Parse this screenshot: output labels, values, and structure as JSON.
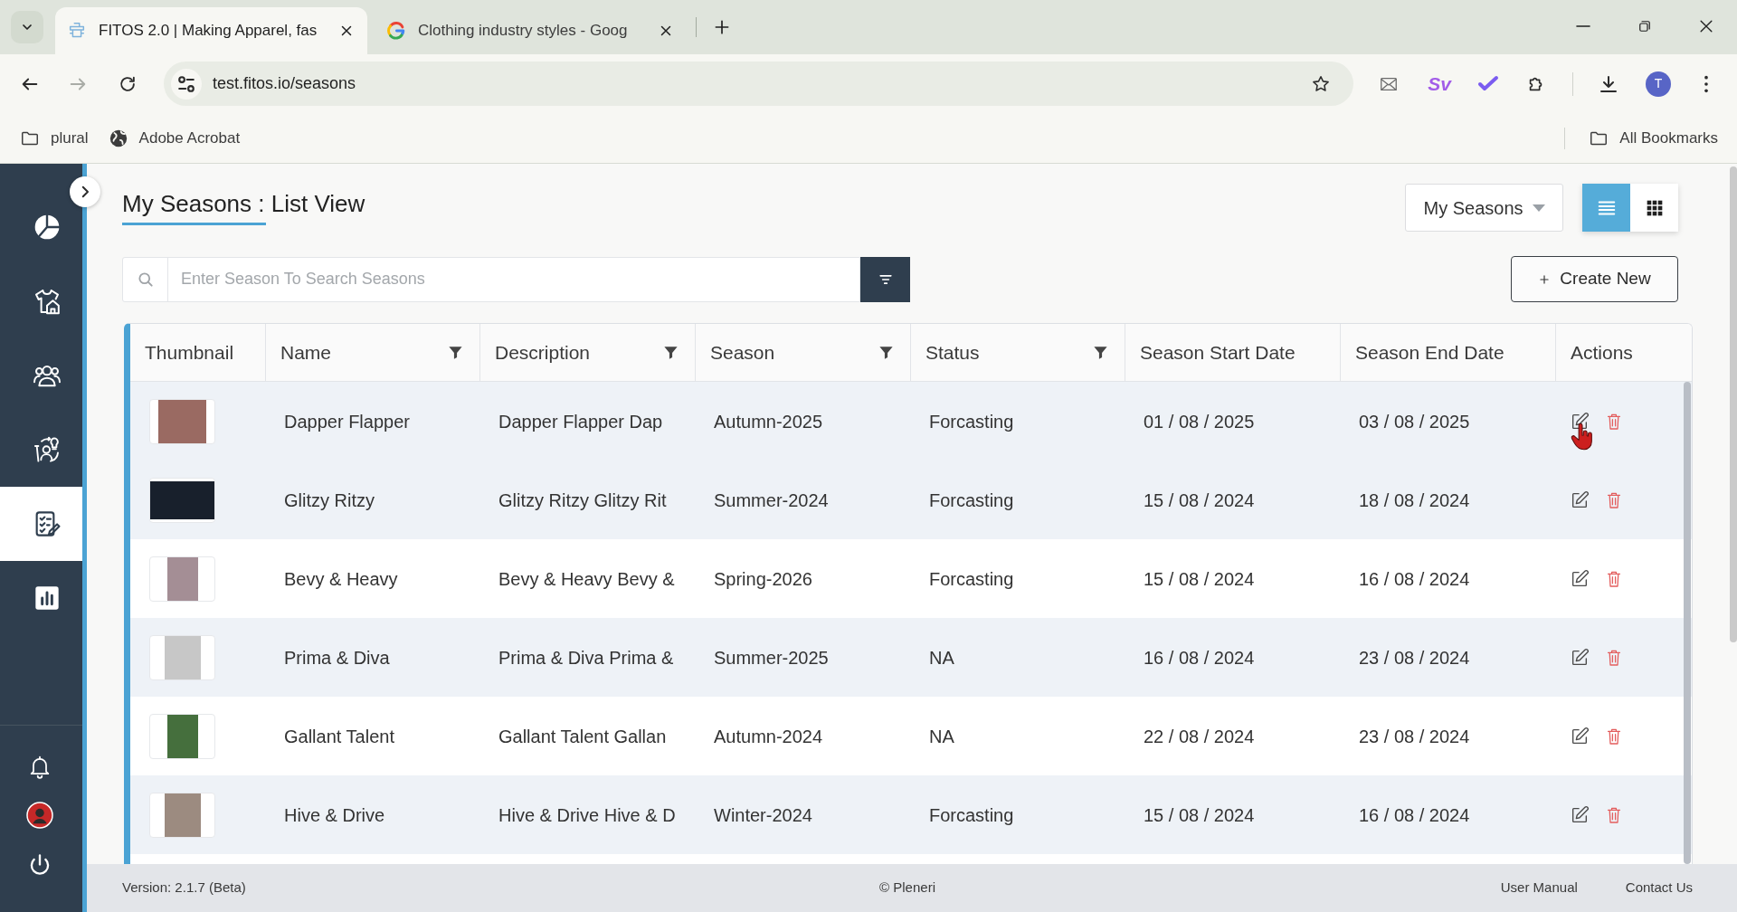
{
  "browser": {
    "tabs": [
      {
        "title": "FITOS 2.0 | Making Apparel, fas",
        "selected": true
      },
      {
        "title": "Clothing industry styles - Goog",
        "selected": false
      }
    ],
    "address": "test.fitos.io/seasons",
    "extension_label": "Sv",
    "profile_initial": "T",
    "bookmarks": [
      {
        "label": "plural",
        "kind": "folder"
      },
      {
        "label": "Adobe Acrobat",
        "kind": "site"
      }
    ],
    "all_bookmarks": "All Bookmarks"
  },
  "sidebar": {
    "items": [
      {
        "selected": false
      },
      {
        "selected": false
      },
      {
        "selected": false
      },
      {
        "selected": false
      },
      {
        "selected": true
      },
      {
        "selected": false
      }
    ]
  },
  "page": {
    "title": "My Seasons : List View",
    "view_menu": "My Seasons",
    "view_modes": [
      {
        "kind": "list",
        "selected": true
      },
      {
        "kind": "grid",
        "selected": false
      }
    ],
    "search": {
      "placeholder": "Enter Season To Search Seasons"
    },
    "create_button": "Create New"
  },
  "table": {
    "columns": [
      {
        "label": "Thumbnail",
        "filter": false
      },
      {
        "label": "Name",
        "filter": true
      },
      {
        "label": "Description",
        "filter": true
      },
      {
        "label": "Season",
        "filter": true
      },
      {
        "label": "Status",
        "filter": true
      },
      {
        "label": "Season Start Date",
        "filter": false
      },
      {
        "label": "Season End Date",
        "filter": false
      },
      {
        "label": "Actions",
        "filter": false
      }
    ],
    "rows": [
      {
        "name": "Dapper Flapper",
        "description": "Dapper Flapper Dap",
        "season": "Autumn-2025",
        "status": "Forcasting",
        "start_date": "01 / 08 / 2025",
        "end_date": "03 / 08 / 2025",
        "hovered": true
      },
      {
        "name": "Glitzy Ritzy",
        "description": "Glitzy Ritzy Glitzy Rit",
        "season": "Summer-2024",
        "status": "Forcasting",
        "start_date": "15 / 08 / 2024",
        "end_date": "18 / 08 / 2024",
        "hovered": false
      },
      {
        "name": "Bevy & Heavy",
        "description": "Bevy & Heavy Bevy &",
        "season": "Spring-2026",
        "status": "Forcasting",
        "start_date": "15 / 08 / 2024",
        "end_date": "16 / 08 / 2024",
        "hovered": false
      },
      {
        "name": "Prima & Diva",
        "description": "Prima & Diva Prima &",
        "season": "Summer-2025",
        "status": "NA",
        "start_date": "16 / 08 / 2024",
        "end_date": "23 / 08 / 2024",
        "hovered": false
      },
      {
        "name": "Gallant Talent",
        "description": "Gallant Talent Gallan",
        "season": "Autumn-2024",
        "status": "NA",
        "start_date": "22 / 08 / 2024",
        "end_date": "23 / 08 / 2024",
        "hovered": false
      },
      {
        "name": "Hive & Drive",
        "description": "Hive & Drive Hive & D",
        "season": "Winter-2024",
        "status": "Forcasting",
        "start_date": "15 / 08 / 2024",
        "end_date": "16 / 08 / 2024",
        "hovered": false
      }
    ]
  },
  "footer": {
    "version": "Version: 2.1.7 (Beta)",
    "copyright": "© Pleneri",
    "links": [
      "User Manual",
      "Contact Us"
    ]
  }
}
